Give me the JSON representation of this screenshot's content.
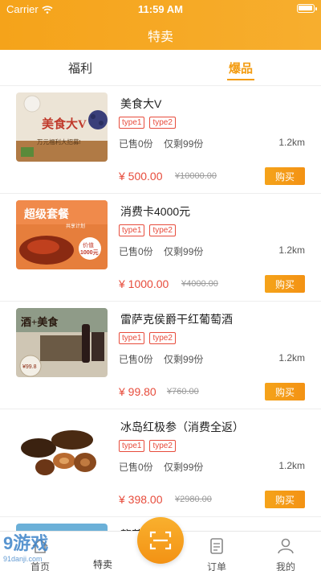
{
  "status_bar": {
    "carrier": "Carrier",
    "time": "11:59 AM"
  },
  "header": {
    "title": "特卖"
  },
  "tabs": [
    {
      "label": "福利",
      "active": false
    },
    {
      "label": "爆品",
      "active": true
    }
  ],
  "products": [
    {
      "name": "美食大V",
      "tags": [
        "type1",
        "type2"
      ],
      "sold": "已售0份",
      "remaining": "仅剩99份",
      "distance": "1.2km",
      "price": "¥ 500.00",
      "old_price": "¥10000.00",
      "buy_label": "购买",
      "image_text": "美食大V",
      "image_subtext": "万元福利大招募!"
    },
    {
      "name": "消费卡4000元",
      "tags": [
        "type1",
        "type2"
      ],
      "sold": "已售0份",
      "remaining": "仅剩99份",
      "distance": "1.2km",
      "price": "¥ 1000.00",
      "old_price": "¥4000.00",
      "buy_label": "购买",
      "image_text": "超级套餐",
      "image_subtext": "共享计划",
      "image_badge": "价值\n1000元"
    },
    {
      "name": "雷萨克侯爵干红葡萄酒",
      "tags": [
        "type1",
        "type2"
      ],
      "sold": "已售0份",
      "remaining": "仅剩99份",
      "distance": "1.2km",
      "price": "¥ 99.80",
      "old_price": "¥760.00",
      "buy_label": "购买",
      "image_text": "酒+美食",
      "image_badge": "¥99.8"
    },
    {
      "name": "冰岛红极参（消费全返）",
      "tags": [
        "type1",
        "type2"
      ],
      "sold": "已售0份",
      "remaining": "仅剩99份",
      "distance": "1.2km",
      "price": "¥ 398.00",
      "old_price": "¥2980.00",
      "buy_label": "购买"
    },
    {
      "name": "龍营",
      "partial": true
    }
  ],
  "tabbar": {
    "home": "首页",
    "sale": "特卖",
    "order": "订单",
    "mine": "我的"
  },
  "watermark": {
    "logo": "9游戏",
    "site": "91danji.com"
  },
  "colors": {
    "accent": "#f5a31a",
    "price": "#e74c3c"
  }
}
